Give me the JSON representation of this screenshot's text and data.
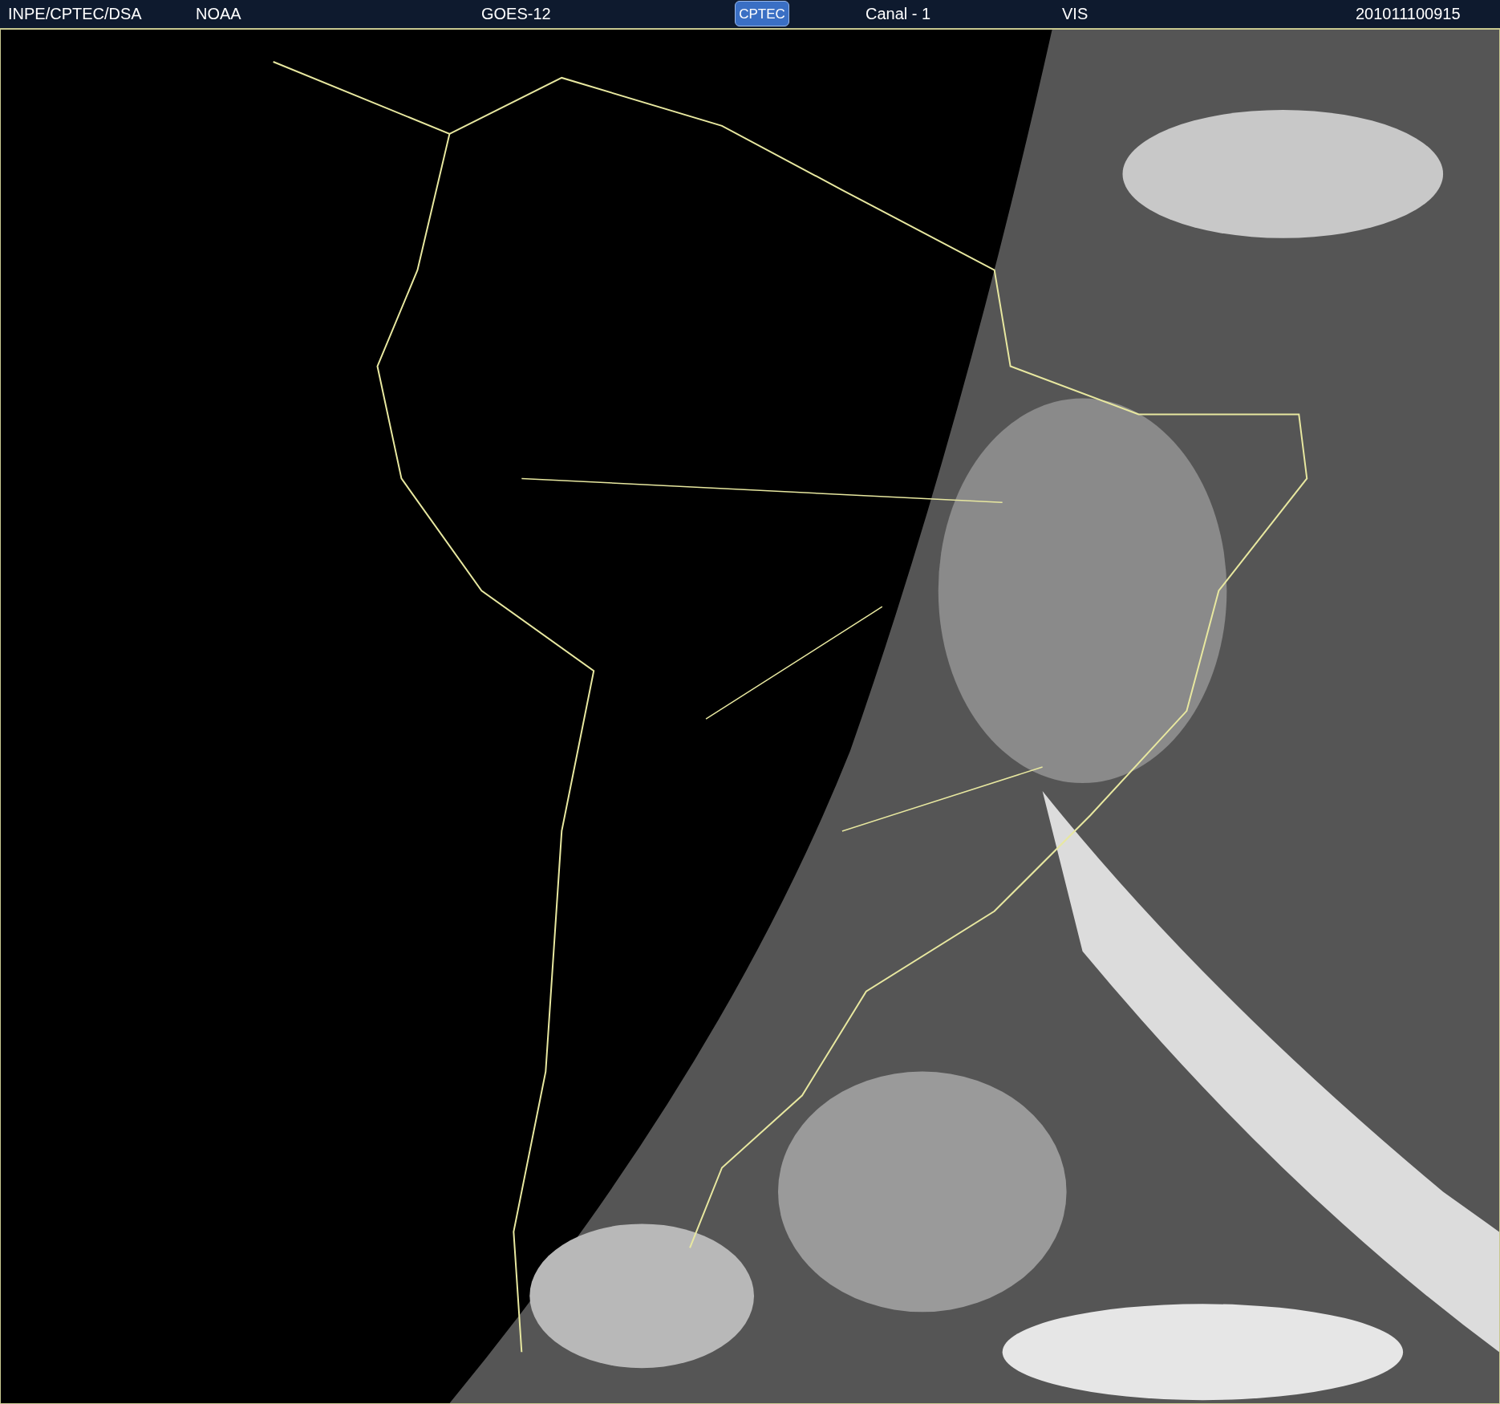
{
  "header": {
    "source": "INPE/CPTEC/DSA",
    "agency": "NOAA",
    "satellite": "GOES-12",
    "logo": "CPTEC",
    "channel": "Canal - 1",
    "band": "VIS",
    "timestamp": "201011100915"
  }
}
